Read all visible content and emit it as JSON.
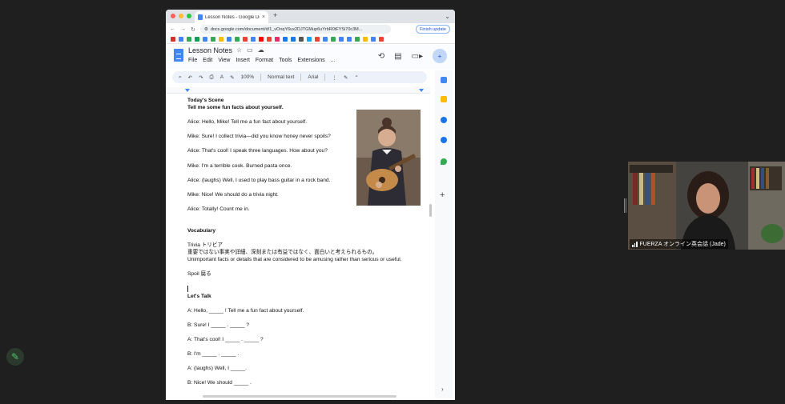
{
  "browser": {
    "tab_title": "Lesson Notes - Google Docs",
    "tab_close": "×",
    "new_tab": "+",
    "window_menu": "⌄",
    "url": "docs.google.com/document/d/1_vOnqY6ux2DJTGMup6uYrbR0tFYSi70c3M...",
    "finish_update": "Finish update"
  },
  "docs": {
    "title": "Lesson Notes",
    "menus": [
      "File",
      "Edit",
      "View",
      "Insert",
      "Format",
      "Tools",
      "Extensions",
      "..."
    ],
    "zoom": "100%",
    "style": "Normal text",
    "font": "Arial"
  },
  "document": {
    "lines": [
      {
        "text": "Today's Scene",
        "bold": true
      },
      {
        "text": "Tell me some fun facts about yourself.",
        "bold": true
      },
      {
        "text": "Alice: Hello, Mike! Tell me a fun fact about yourself.",
        "bold": false
      },
      {
        "text": "Mike: Sure! I collect trivia—did you know honey never spoils?",
        "bold": false
      },
      {
        "text": "Alice: That's cool! I speak three languages. How about you?",
        "bold": false
      },
      {
        "text": "Mike: I'm a terrible cook. Burned pasta once.",
        "bold": false
      },
      {
        "text": "Alice: (laughs) Well, I used to play bass guitar in a rock band.",
        "bold": false
      },
      {
        "text": "Mike: Nice! We should do a trivia night.",
        "bold": false
      },
      {
        "text": "Alice: Totally! Count me in.",
        "bold": false
      },
      {
        "text": "Vocabulary",
        "bold": true
      },
      {
        "text": "Trivia トリビア",
        "bold": false
      },
      {
        "text": "重要ではない事実や詳細、深刻または有益ではなく、面白いと考えられるもの。",
        "bold": false
      },
      {
        "text": "Unimportant facts or details that are considered to be amusing rather than serious or useful.",
        "bold": false
      },
      {
        "text": "Spoil 腐る",
        "bold": false
      },
      {
        "text": "Let's Talk",
        "bold": true
      },
      {
        "text": "A: Hello, _____ ! Tell me a fun fact about yourself.",
        "bold": false
      },
      {
        "text": "B: Sure! I _____ . _____ ?",
        "bold": false
      },
      {
        "text": "A: That's cool! I _____ . _____ ?",
        "bold": false
      },
      {
        "text": "B: I'm _____ . _____ .",
        "bold": false
      },
      {
        "text": "A: (laughs) Well, I _____.",
        "bold": false
      },
      {
        "text": "B: Nice! We should _____ .",
        "bold": false
      }
    ]
  },
  "video": {
    "participant": "FUERZA オンライン英会話 (Jade)"
  },
  "colors": {
    "background": "#1f1f1f",
    "docs_blue": "#4285f4",
    "toolbar": "#edf2fa",
    "annotate_green": "#4fc36b"
  },
  "icons": {
    "annotate": "pencil-icon",
    "share": "add-person-icon",
    "history": "history-icon",
    "comments": "comment-icon",
    "meet": "video-camera-icon"
  }
}
